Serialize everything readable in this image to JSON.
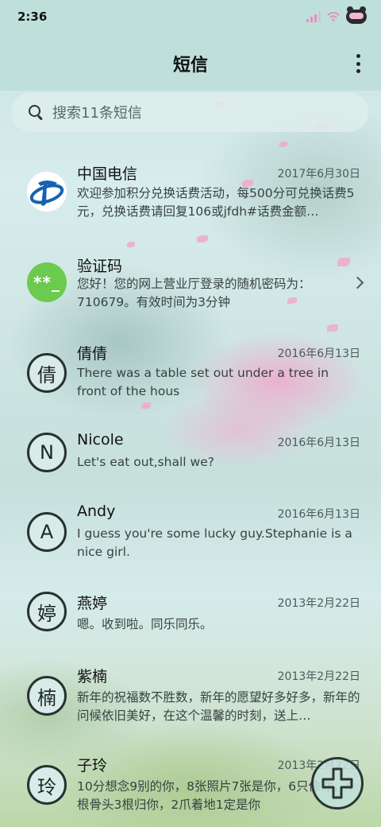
{
  "status": {
    "time": "2:36"
  },
  "header": {
    "title": "短信"
  },
  "search": {
    "placeholder": "搜索11条短信"
  },
  "colors": {
    "accent": "#6ccb4f",
    "avatar_border": "#273230",
    "bar": "#bfe0da"
  },
  "messages": [
    {
      "avatar_type": "logo",
      "avatar_icon": "china-telecom-logo",
      "name": "中国电信",
      "date": "2017年6月30日",
      "preview": "欢迎参加积分兑换话费活动，每500分可兑换话费5元，兑换话费请回复106或jfdh#话费金额…"
    },
    {
      "avatar_type": "code",
      "avatar_text": "**_",
      "name": "验证码",
      "date": "",
      "preview": "您好！您的网上营业厅登录的随机密码为：710679。有效时间为3分钟"
    },
    {
      "avatar_type": "letter",
      "avatar_text": "倩",
      "name": "倩倩",
      "date": "2016年6月13日",
      "preview": "There was a table set out under a tree in front of the hous"
    },
    {
      "avatar_type": "letter",
      "avatar_text": "N",
      "name": "Nicole",
      "date": "2016年6月13日",
      "preview": "Let's eat out,shall we?"
    },
    {
      "avatar_type": "letter",
      "avatar_text": "A",
      "name": "Andy",
      "date": "2016年6月13日",
      "preview": "I guess you're some lucky guy.Stephanie is a nice girl."
    },
    {
      "avatar_type": "letter",
      "avatar_text": "婷",
      "name": "燕婷",
      "date": "2013年2月22日",
      "preview": "嗯。收到啦。同乐同乐。"
    },
    {
      "avatar_type": "letter",
      "avatar_text": "楠",
      "name": "紫楠",
      "date": "2013年2月22日",
      "preview": "新年的祝福数不胜数，新年的愿望好多好多，新年的问候依旧美好，在这个温馨的时刻，送上…"
    },
    {
      "avatar_type": "letter",
      "avatar_text": "玲",
      "name": "子玲",
      "date": "2013年2月22日",
      "preview": "10分想念9别的你，8张照片7张是你，6只像你，4根骨头3根归你，2爪着地1定是你"
    }
  ]
}
